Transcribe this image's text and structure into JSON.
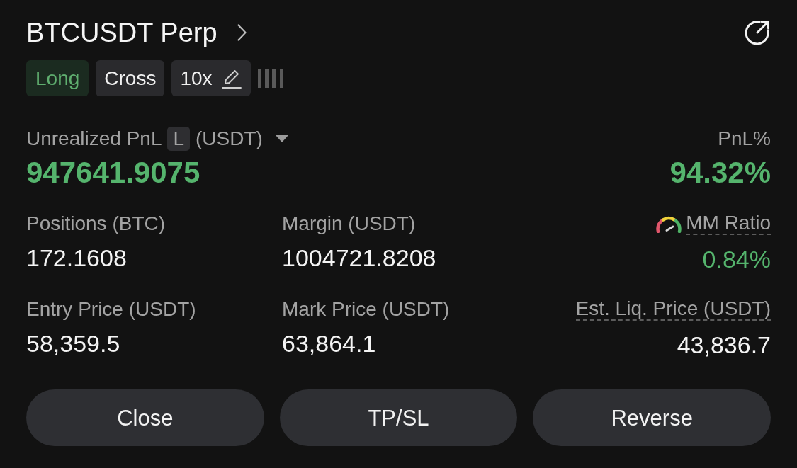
{
  "header": {
    "title": "BTCUSDT Perp"
  },
  "tags": [
    {
      "kind": "side",
      "label": "Long"
    },
    {
      "kind": "mode",
      "label": "Cross"
    },
    {
      "kind": "leverage",
      "label": "10x"
    }
  ],
  "pnl": {
    "label": "Unrealized PnL",
    "badge": "L",
    "unit": "(USDT)",
    "value": "947641.9075"
  },
  "pnl_percent": {
    "label": "PnL%",
    "value": "94.32%"
  },
  "stats": [
    {
      "kind": "plain",
      "label": "Positions (BTC)",
      "value": "172.1608"
    },
    {
      "kind": "plain",
      "label": "Margin (USDT)",
      "value": "1004721.8208"
    },
    {
      "kind": "gauge",
      "label": "MM Ratio",
      "value": "0.84%"
    },
    {
      "kind": "plain",
      "label": "Entry Price (USDT)",
      "value": "58,359.5"
    },
    {
      "kind": "plain",
      "label": "Mark Price (USDT)",
      "value": "63,864.1"
    },
    {
      "kind": "hint",
      "label": "Est. Liq. Price (USDT)",
      "value": "43,836.7"
    }
  ],
  "buttons": [
    {
      "label": "Close"
    },
    {
      "label": "TP/SL"
    },
    {
      "label": "Reverse"
    }
  ]
}
